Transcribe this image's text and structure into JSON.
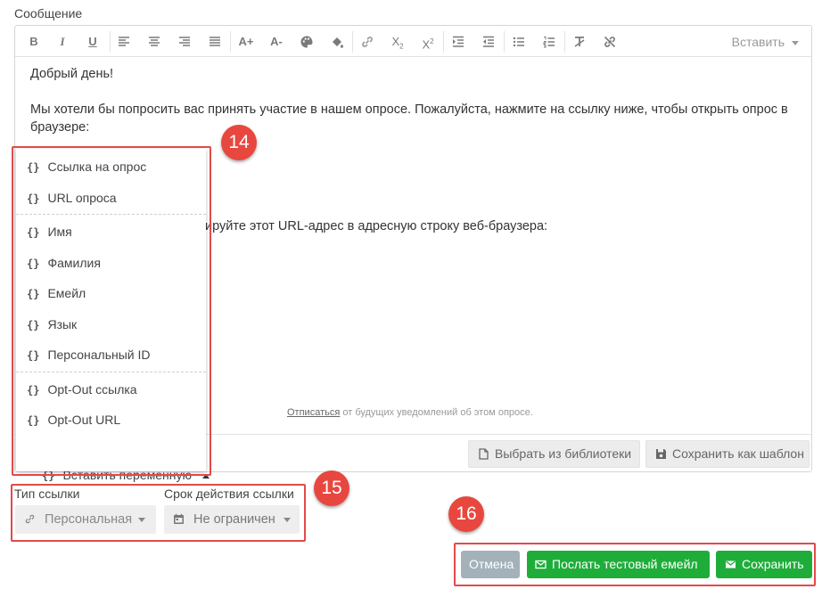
{
  "message_label": "Сообщение",
  "toolbar": {
    "buttons": [
      "B",
      "I",
      "U",
      "align-left",
      "align-center",
      "align-right",
      "align-justify",
      "A+",
      "A-",
      "palette",
      "fill",
      "link",
      "X2",
      "X2",
      "indent",
      "outdent",
      "bullet-list",
      "numbered-list",
      "clear-format",
      "no-link"
    ],
    "insert_label": "Вставить"
  },
  "content": {
    "greeting": "Добрый день!",
    "line1": "Мы хотели бы попросить вас принять участие в нашем опросе. Пожалуйста, нажмите на ссылку ниже, чтобы открыть опрос в",
    "line2": "браузере:",
    "line3_partial": "ируйте этот URL-адрес в адресную строку веб-браузера:",
    "unsubscribe_link": "Отписаться",
    "unsubscribe_rest": " от будущих уведомлений об этом опросе."
  },
  "menu": {
    "brace": "{}",
    "items": [
      "Ссылка на опрос",
      "URL опроса",
      "Имя",
      "Фамилия",
      "Емейл",
      "Язык",
      "Персональный ID",
      "Opt-Out ссылка",
      "Opt-Out URL"
    ],
    "toggle_label": "Вставить переменную"
  },
  "bottom_bar": {
    "library_label": "Выбрать из библиотеки",
    "save_template_label": "Сохранить как шаблон"
  },
  "link_settings": {
    "type_label": "Тип ссылки",
    "type_value": "Персональная",
    "expiry_label": "Срок действия ссылки",
    "expiry_value": "Не ограничен"
  },
  "actions": {
    "cancel_label": "Отмена",
    "test_email_label": "Послать тестовый емейл",
    "save_label": "Сохранить"
  },
  "badges": {
    "b14": "14",
    "b15": "15",
    "b16": "16"
  },
  "colors": {
    "annotation_red": "#e8473f",
    "success_green": "#1fad3a",
    "cancel_gray": "#a3b1ba"
  }
}
